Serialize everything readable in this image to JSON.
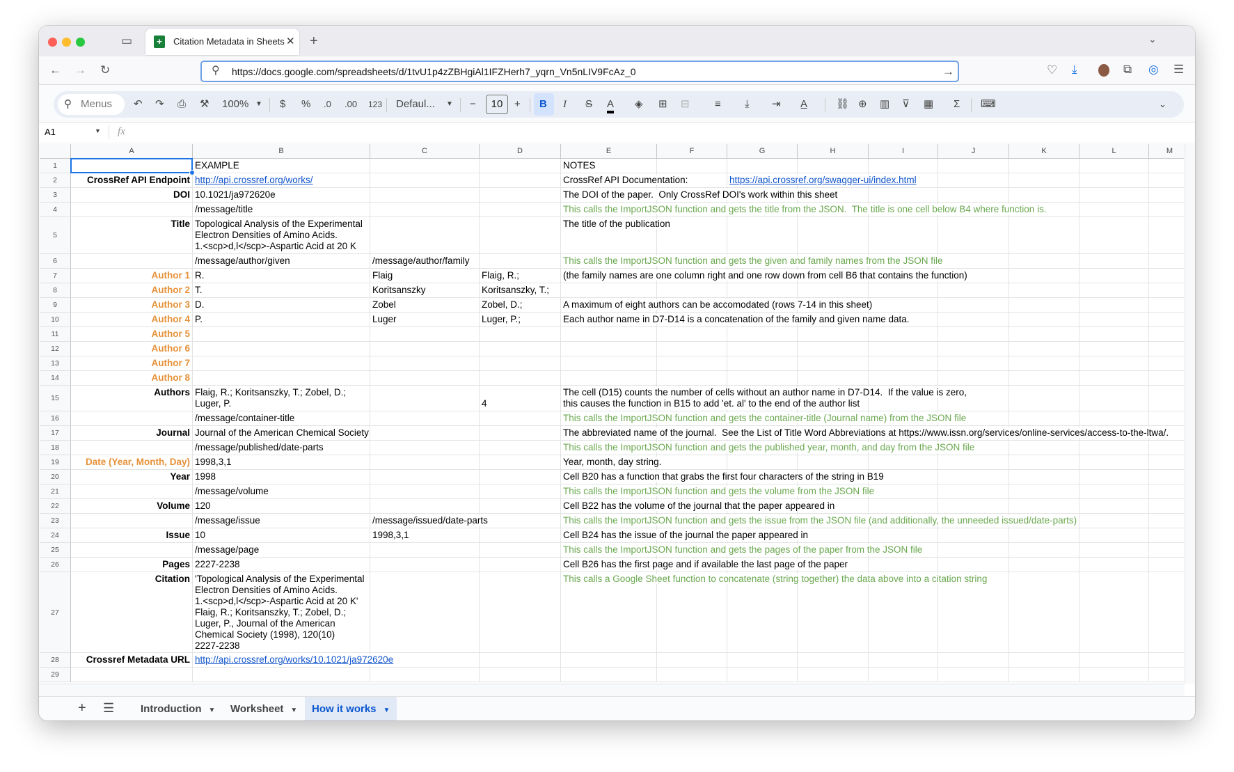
{
  "browser": {
    "tab_title": "Citation Metadata in Sheets - Google Sheets",
    "new_tab": "+",
    "url": "https://docs.google.com/spreadsheets/d/1tvU1p4zZBHgiAl1IFZHerh7_yqrn_Vn5nLIV9FcAz_0"
  },
  "toolbar": {
    "menus_placeholder": "Menus",
    "zoom": "100%",
    "currency": "$",
    "percent": "%",
    "decrease_decimal": ".0",
    "increase_decimal": ".00",
    "number_format": "123",
    "font": "Defaul...",
    "font_size": "10",
    "minus": "−",
    "plus": "+",
    "bold": "B",
    "italic": "I",
    "strike": "S",
    "text_color": "A",
    "sigma": "Σ"
  },
  "formula_bar": {
    "cell_ref": "A1",
    "fx": "fx",
    "value": ""
  },
  "colors": {
    "accent": "#1a73e8",
    "orange": "#e69138",
    "green": "#6aa84f",
    "link": "#1155cc"
  },
  "grid": {
    "columns": [
      "A",
      "B",
      "C",
      "D",
      "E",
      "F",
      "G",
      "H",
      "I",
      "J",
      "K",
      "L",
      "M"
    ],
    "selected_cell": "A1",
    "rows": [
      {
        "n": "1",
        "cells": {
          "B": {
            "t": "EXAMPLE"
          },
          "E": {
            "t": "NOTES"
          }
        }
      },
      {
        "n": "2",
        "cells": {
          "A": {
            "t": "CrossRef API Endpoint",
            "s": "bold"
          },
          "B": {
            "t": "http://api.crossref.org/works/",
            "s": "link"
          },
          "E": {
            "t": "CrossRef API Documentation:"
          },
          "G": {
            "t": "https://api.crossref.org/swagger-ui/index.html",
            "s": "link"
          }
        }
      },
      {
        "n": "3",
        "cells": {
          "A": {
            "t": "DOI",
            "s": "bold"
          },
          "B": {
            "t": "10.1021/ja972620e"
          },
          "E": {
            "t": "The DOI of the paper.  Only CrossRef DOI's work within this sheet"
          }
        }
      },
      {
        "n": "4",
        "cells": {
          "B": {
            "t": "/message/title"
          },
          "E": {
            "t": "This calls the ImportJSON function and gets the title from the JSON.  The title is one cell below B4 where function is.",
            "s": "green"
          }
        }
      },
      {
        "n": "5",
        "cells": {
          "A": {
            "t": "Title",
            "s": "bold"
          },
          "B": {
            "t": "Topological Analysis of the Experimental\nElectron Densities of Amino Acids.\n1.<scp>d,l</scp>-Aspartic Acid at 20 K"
          },
          "E": {
            "t": "The title of the publication"
          }
        }
      },
      {
        "n": "6",
        "cells": {
          "B": {
            "t": "/message/author/given"
          },
          "C": {
            "t": "/message/author/family"
          },
          "E": {
            "t": "This calls the ImportJSON function and gets the given and family names from the JSON file",
            "s": "green"
          }
        }
      },
      {
        "n": "7",
        "cells": {
          "A": {
            "t": "Author 1",
            "s": "orange"
          },
          "B": {
            "t": "R."
          },
          "C": {
            "t": "Flaig"
          },
          "D": {
            "t": "Flaig, R.;"
          },
          "E": {
            "t": "(the family names are one column right and one row down from cell B6 that contains the function)"
          }
        }
      },
      {
        "n": "8",
        "cells": {
          "A": {
            "t": "Author 2",
            "s": "orange"
          },
          "B": {
            "t": "T."
          },
          "C": {
            "t": "Koritsanszky"
          },
          "D": {
            "t": "Koritsanszky, T.;"
          }
        }
      },
      {
        "n": "9",
        "cells": {
          "A": {
            "t": "Author 3",
            "s": "orange"
          },
          "B": {
            "t": "D."
          },
          "C": {
            "t": "Zobel"
          },
          "D": {
            "t": "Zobel, D.;"
          },
          "E": {
            "t": "A maximum of eight authors can be accomodated (rows 7-14 in this sheet)"
          }
        }
      },
      {
        "n": "10",
        "cells": {
          "A": {
            "t": "Author 4",
            "s": "orange"
          },
          "B": {
            "t": "P."
          },
          "C": {
            "t": "Luger"
          },
          "D": {
            "t": "Luger, P.;"
          },
          "E": {
            "t": "Each author name in D7-D14 is a concatenation of the family and given name data."
          }
        }
      },
      {
        "n": "11",
        "cells": {
          "A": {
            "t": "Author 5",
            "s": "orange"
          }
        }
      },
      {
        "n": "12",
        "cells": {
          "A": {
            "t": "Author 6",
            "s": "orange"
          }
        }
      },
      {
        "n": "13",
        "cells": {
          "A": {
            "t": "Author 7",
            "s": "orange"
          }
        }
      },
      {
        "n": "14",
        "cells": {
          "A": {
            "t": "Author 8",
            "s": "orange"
          }
        }
      },
      {
        "n": "15",
        "cells": {
          "A": {
            "t": "Authors",
            "s": "bold"
          },
          "B": {
            "t": "Flaig, R.; Koritsanszky, T.; Zobel, D.;\nLuger, P."
          },
          "D": {
            "t": "4",
            "s": "bottom"
          },
          "E": {
            "t": "The cell (D15) counts the number of cells without an author name in D7-D14.  If the value is zero,\nthis causes the function in B15 to add 'et. al' to the end of the author list"
          }
        }
      },
      {
        "n": "16",
        "cells": {
          "B": {
            "t": "/message/container-title"
          },
          "E": {
            "t": "This calls the ImportJSON function and gets the container-title (Journal name) from the JSON file",
            "s": "green"
          }
        }
      },
      {
        "n": "17",
        "cells": {
          "A": {
            "t": "Journal",
            "s": "bold"
          },
          "B": {
            "t": "Journal of the American Chemical Society"
          },
          "E": {
            "t": "The abbreviated name of the journal.  See the List of Title Word Abbreviations at https://www.issn.org/services/online-services/access-to-the-ltwa/."
          }
        }
      },
      {
        "n": "18",
        "cells": {
          "B": {
            "t": "/message/published/date-parts"
          },
          "E": {
            "t": "This calls the ImportJSON function and gets the published year, month, and day from the JSON file",
            "s": "green"
          }
        }
      },
      {
        "n": "19",
        "cells": {
          "A": {
            "t": "Date (Year, Month, Day)",
            "s": "orange"
          },
          "B": {
            "t": "1998,3,1"
          },
          "E": {
            "t": "Year, month, day string."
          }
        }
      },
      {
        "n": "20",
        "cells": {
          "A": {
            "t": "Year",
            "s": "bold"
          },
          "B": {
            "t": "1998"
          },
          "E": {
            "t": "Cell B20 has a function that grabs the first four characters of the string in B19"
          }
        }
      },
      {
        "n": "21",
        "cells": {
          "B": {
            "t": "/message/volume"
          },
          "E": {
            "t": "This calls the ImportJSON function and gets the volume from the JSON file",
            "s": "green"
          }
        }
      },
      {
        "n": "22",
        "cells": {
          "A": {
            "t": "Volume",
            "s": "bold"
          },
          "B": {
            "t": "120"
          },
          "E": {
            "t": "Cell B22 has the volume of the journal that the paper appeared in"
          }
        }
      },
      {
        "n": "23",
        "cells": {
          "B": {
            "t": "/message/issue"
          },
          "C": {
            "t": "/message/issued/date-parts"
          },
          "E": {
            "t": "This calls the ImportJSON function and gets the issue from the JSON file (and additionally, the unneeded issued/date-parts)",
            "s": "green"
          }
        }
      },
      {
        "n": "24",
        "cells": {
          "A": {
            "t": "Issue",
            "s": "bold"
          },
          "B": {
            "t": "10"
          },
          "C": {
            "t": "1998,3,1"
          },
          "E": {
            "t": "Cell B24 has the issue of the journal the paper appeared in"
          }
        }
      },
      {
        "n": "25",
        "cells": {
          "B": {
            "t": "/message/page"
          },
          "E": {
            "t": "This calls the ImportJSON function and gets the pages of the paper from the JSON file",
            "s": "green"
          }
        }
      },
      {
        "n": "26",
        "cells": {
          "A": {
            "t": "Pages",
            "s": "bold"
          },
          "B": {
            "t": "2227-2238"
          },
          "E": {
            "t": "Cell B26 has the first page and if available the last page of the paper"
          }
        }
      },
      {
        "n": "27",
        "cells": {
          "A": {
            "t": "Citation",
            "s": "bold"
          },
          "B": {
            "t": "'Topological Analysis of the Experimental\nElectron Densities of Amino Acids.\n1.<scp>d,l</scp>-Aspartic Acid at 20 K'\nFlaig, R.; Koritsanszky, T.; Zobel, D.;\nLuger, P., Journal of the American\nChemical Society (1998), 120(10)\n2227-2238"
          },
          "E": {
            "t": "This calls a Google Sheet function to concatenate (string together) the data above into a citation string",
            "s": "green"
          }
        }
      },
      {
        "n": "28",
        "cells": {
          "A": {
            "t": "Crossref Metadata URL",
            "s": "bold"
          },
          "B": {
            "t": "http://api.crossref.org/works/10.1021/ja972620e",
            "s": "link"
          }
        }
      },
      {
        "n": "29",
        "cells": {}
      }
    ]
  },
  "sheet_tabs": [
    {
      "label": "Introduction",
      "active": false
    },
    {
      "label": "Worksheet",
      "active": false
    },
    {
      "label": "How it works",
      "active": true
    }
  ]
}
